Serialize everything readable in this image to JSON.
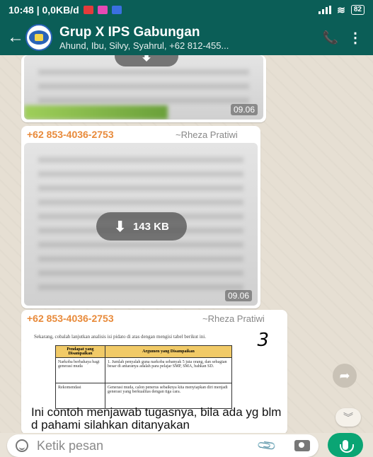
{
  "status_bar": {
    "time_info": "10:48 | 0,0KB/d",
    "battery": "82"
  },
  "header": {
    "title": "Grup X IPS Gabungan",
    "subtitle": "Ahund, Ibu, Silvy, Syahrul, +62 812-455..."
  },
  "messages": [
    {
      "type": "image",
      "time": "09.06"
    },
    {
      "type": "image",
      "sender_number": "+62 853-4036-2753",
      "sender_alias": "~Rheza Pratiwi",
      "download_size": "143 KB",
      "time": "09.06"
    },
    {
      "type": "image_with_caption",
      "sender_number": "+62 853-4036-2753",
      "sender_alias": "~Rheza Pratiwi",
      "doc": {
        "intro": "Sekarang, cobalah lanjutkan analisis isi pidato di atas dengan mengisi tabel berikut ini.",
        "page_mark": "3",
        "col_left": "Pendapat yang Disampaikan",
        "col_right": "Argumen yang Disampaikan",
        "row1_left": "Narkoba berbahaya bagi generasi muda",
        "row1_right": "1. Jumlah penyalah guna narkoba sebanyak 5 juta orang, dan sebagian besar di antaranya adalah para pelajar SMP, SMA, bahkan SD.",
        "row2_left": "Rekomendasi",
        "row2_right": "Generasi muda, calon penerus sebaiknya kita menyiapkan diri menjadi generasi yang berkualitas dengan tiga cara."
      },
      "caption": "Ini contoh menjawab tugasnya, bila ada yg blm d pahami silahkan ditanyakan"
    }
  ],
  "input": {
    "placeholder": "Ketik pesan"
  },
  "colors": {
    "header": "#0b5e57",
    "sender_number": "#e88a3a",
    "mic_button": "#0aa574"
  }
}
